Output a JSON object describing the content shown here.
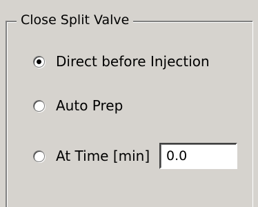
{
  "groupbox": {
    "title": "Close Split Valve"
  },
  "options": [
    {
      "label": "Direct before Injection",
      "selected": true
    },
    {
      "label": "Auto Prep",
      "selected": false
    },
    {
      "label": "At Time [min]",
      "selected": false
    }
  ],
  "time_input": {
    "value": "0.0"
  },
  "colors": {
    "background": "#d6d3ce",
    "input_background": "#ffffff"
  }
}
